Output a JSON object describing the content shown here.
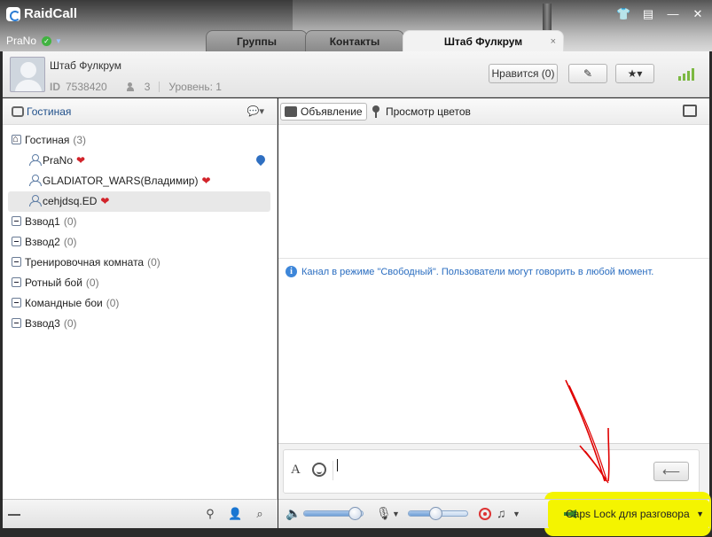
{
  "app": {
    "name": "RaidCall"
  },
  "user": {
    "name": "PraNo"
  },
  "window_buttons": [
    "shirt-icon",
    "menu-icon",
    "minimize-icon",
    "close-icon"
  ],
  "tabs": [
    {
      "label": "Группы"
    },
    {
      "label": "Контакты"
    },
    {
      "label": "Штаб Фулкрум",
      "close": "×"
    }
  ],
  "channel": {
    "title": "Штаб Фулкрум",
    "id_label": "ID",
    "id": "7538420",
    "members": "3",
    "level": "Уровень: 1",
    "like_button": "Нравится (0)"
  },
  "left": {
    "toolbar_label": "Гостиная",
    "tree": [
      {
        "type": "group",
        "name": "Гостиная",
        "count": "(3)"
      },
      {
        "type": "user",
        "name": "PraNo",
        "heart": "❤"
      },
      {
        "type": "user",
        "name": "GLADIATOR_WARS(Владимир)",
        "heart": "❤"
      },
      {
        "type": "user",
        "name": "cehjdsq.ED",
        "heart": "❤"
      },
      {
        "type": "group",
        "name": "Взвод1",
        "count": "(0)"
      },
      {
        "type": "group",
        "name": "Взвод2",
        "count": "(0)"
      },
      {
        "type": "group",
        "name": "Тренировочная комната",
        "count": "(0)"
      },
      {
        "type": "group",
        "name": "Ротный бой",
        "count": "(0)"
      },
      {
        "type": "group",
        "name": "Командные бои",
        "count": "(0)"
      },
      {
        "type": "group",
        "name": "Взвод3",
        "count": "(0)"
      }
    ]
  },
  "right": {
    "announcement": "Объявление",
    "flowers": "Просмотр цветов",
    "notice": "Канал в режиме \"Свободный\". Пользователи могут говорить в любой момент.",
    "send_symbol": "⟵"
  },
  "footer": {
    "volume": 0.85,
    "mic_level": 0.45,
    "ptt_label": "Caps Lock для разговора"
  },
  "colors": {
    "accent": "#2a6dc0",
    "highlight": "#f4f400",
    "annotation": "#e00000"
  }
}
